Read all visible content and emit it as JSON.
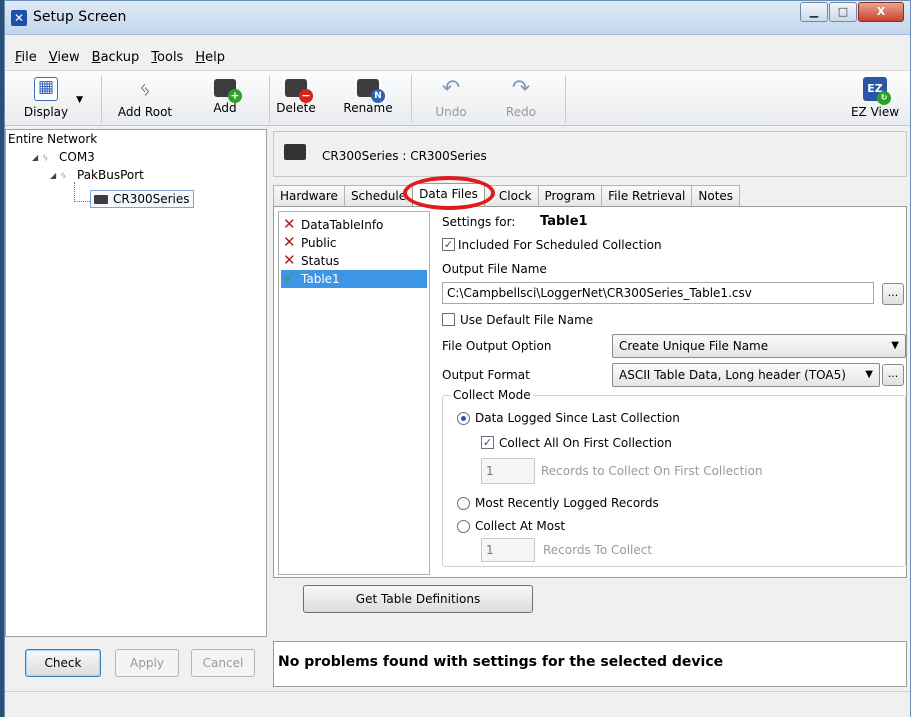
{
  "window": {
    "title": "Setup Screen",
    "min_icon": "minimize-icon",
    "max_icon": "maximize-icon",
    "close_glyph": "X"
  },
  "menu": [
    {
      "label": "File",
      "key": "F",
      "rest": "ile"
    },
    {
      "label": "View",
      "key": "V",
      "rest": "iew"
    },
    {
      "label": "Backup",
      "key": "B",
      "rest": "ackup"
    },
    {
      "label": "Tools",
      "key": "T",
      "rest": "ools"
    },
    {
      "label": "Help",
      "key": "H",
      "rest": "elp"
    }
  ],
  "toolbar": {
    "display": "Display",
    "add_root": "Add Root",
    "add": "Add",
    "delete": "Delete",
    "rename": "Rename",
    "undo": "Undo",
    "redo": "Redo",
    "ez_view": "EZ View",
    "ez_badge": "EZ"
  },
  "tree": {
    "title": "Entire Network",
    "nodes": [
      "COM3",
      "PakBusPort",
      "CR300Series"
    ]
  },
  "header": {
    "device": "CR300Series : CR300Series"
  },
  "tabs": [
    "Hardware",
    "Schedule",
    "Data Files",
    "Clock",
    "Program",
    "File Retrieval",
    "Notes"
  ],
  "active_tab": "Data Files",
  "tables": [
    {
      "name": "DataTableInfo",
      "status": "excluded"
    },
    {
      "name": "Public",
      "status": "excluded"
    },
    {
      "name": "Status",
      "status": "excluded"
    },
    {
      "name": "Table1",
      "status": "included",
      "selected": true
    }
  ],
  "settings": {
    "settings_for_label": "Settings for:",
    "settings_for_value": "Table1",
    "included_label": "Included For Scheduled Collection",
    "included_checked": true,
    "output_file_label": "Output File Name",
    "output_file_value": "C:\\Campbellsci\\LoggerNet\\CR300Series_Table1.csv",
    "browse": "...",
    "use_default_label": "Use Default File Name",
    "use_default_checked": false,
    "file_output_option_label": "File Output Option",
    "file_output_option_value": "Create Unique File Name",
    "output_format_label": "Output Format",
    "output_format_value": "ASCII Table Data, Long header (TOA5)",
    "collect_mode_label": "Collect Mode",
    "mode_since_last": "Data Logged Since Last Collection",
    "collect_all_first": "Collect All On First Collection",
    "records_first_value": "1",
    "records_first_label": "Records to Collect On First Collection",
    "mode_most_recent": "Most Recently Logged Records",
    "mode_at_most": "Collect At Most",
    "records_value": "1",
    "records_label": "Records To Collect"
  },
  "buttons": {
    "get_table_definitions": "Get Table Definitions",
    "check": "Check",
    "apply": "Apply",
    "cancel": "Cancel"
  },
  "status_message": "No problems found with settings for the selected device"
}
